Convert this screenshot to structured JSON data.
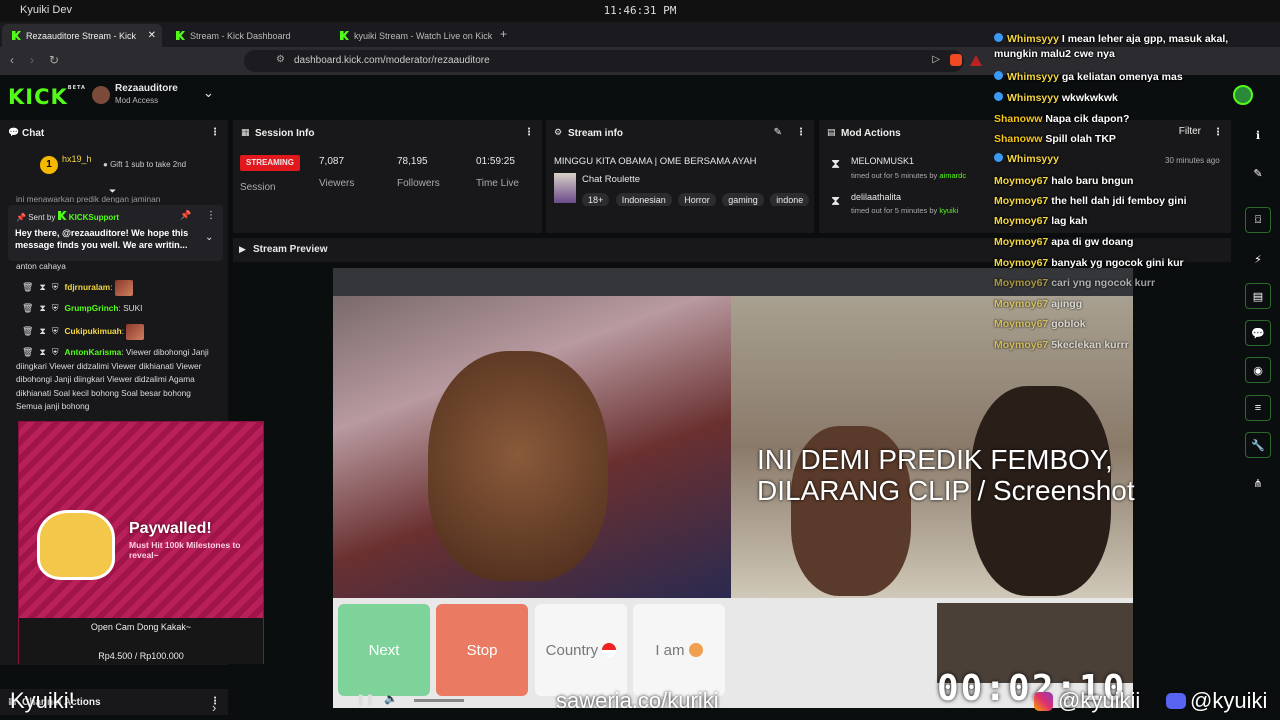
{
  "os": {
    "title": "Kyuiki Dev",
    "time": "11:46:31 PM"
  },
  "tabs": [
    {
      "label": "Rezaauditore Stream - Kick"
    },
    {
      "label": "Stream - Kick Dashboard"
    },
    {
      "label": "kyuiki Stream - Watch Live on Kick"
    }
  ],
  "url": "dashboard.kick.com/moderator/rezaauditore",
  "header": {
    "logo": "KICK",
    "beta": "BETA",
    "channel": "Rezaauditore",
    "role": "Mod Access"
  },
  "chat": {
    "title": "Chat",
    "sub_user": "hx19_h",
    "sub_count": "1",
    "sub_gift_btn": "Gift 1 sub to take 2nd",
    "partial": "ini menawarkan predik dengan jaminan",
    "pinned_by": "Sent by",
    "pinned_user": "KICKSupport",
    "pinned_msg": "Hey there, @rezaauditore! We hope this message finds you well. We are writin...",
    "pre": "anton cahaya",
    "messages": [
      {
        "user": "fdjrnuralam",
        "text": ":",
        "color": "#f5d742"
      },
      {
        "user": "GrumpGrinch",
        "text": ": SUKI",
        "color": "#53fc18"
      },
      {
        "user": "Cukipukimuah",
        "text": ":",
        "color": "#f5d742"
      },
      {
        "user": "AntonKarisma",
        "text": ": Viewer dibohongi Janji diingkari Viewer didzalimi Viewer dikhianati Viewer dibohongi Janji diingkari Viewer didzalimi Agama dikhianati Soal kecil bohong Soal besar bohong Semua janji bohong",
        "color": "#53fc18"
      }
    ]
  },
  "paywall": {
    "title": "Paywalled!",
    "sub": "Must Hit 100k Milestones to reveal~",
    "caption": "Open Cam Dong Kakak~",
    "amount": "Rp4.500 / Rp100.000"
  },
  "channel_actions": "Channel Actions",
  "session": {
    "title": "Session Info",
    "status": "STREAMING",
    "status_label": "Session",
    "viewers": "7,087",
    "viewers_label": "Viewers",
    "followers": "78,195",
    "followers_label": "Followers",
    "time": "01:59:25",
    "time_label": "Time Live"
  },
  "stream_info": {
    "title": "Stream info",
    "stream_title": "MINGGU KITA OBAMA | OME BERSAMA AYAH",
    "category": "Chat Roulette",
    "tags": [
      "18+",
      "Indonesian",
      "Horror",
      "gaming",
      "indone"
    ]
  },
  "mod_actions": {
    "title": "Mod Actions",
    "filter": "Filter",
    "items": [
      {
        "user": "MELONMUSK1",
        "detail": "timed out for 5 minutes by",
        "by": "aimardc"
      },
      {
        "user": "delilaathalita",
        "detail": "timed out for 5 minutes by",
        "by": "kyuiki"
      }
    ]
  },
  "preview": {
    "title": "Stream Preview",
    "overlay_text": "INI DEMI PREDIK FEMBOY, DILARANG CLIP / Screenshot",
    "buttons": [
      "Next",
      "Stop",
      "Country",
      "I am"
    ],
    "timer": "00:02:10"
  },
  "overlay_chat": [
    {
      "user": "Whimsyyy",
      "text": "I mean leher aja gpp, masuk akal, mungkin malu2 cwe nya",
      "color": "#f5d742",
      "icon": true
    },
    {
      "user": "Whimsyyy",
      "text": "ga keliatan omenya mas",
      "color": "#f5d742",
      "icon": true
    },
    {
      "user": "Whimsyyy",
      "text": "wkwkwkwk",
      "color": "#f5d742",
      "icon": true
    },
    {
      "user": "Shanoww",
      "text": "Napa cik dapon?",
      "color": "#f5c518",
      "icon": false
    },
    {
      "user": "Shanoww",
      "text": "Spill olah TKP",
      "color": "#f5c518",
      "icon": false
    },
    {
      "user": "Whimsyyy",
      "text": "",
      "color": "#f5d742",
      "icon": true
    },
    {
      "user": "Moymoy67",
      "text": "halo baru bngun",
      "color": "#f5d742",
      "icon": false
    },
    {
      "user": "Moymoy67",
      "text": "the hell dah jdi femboy gini",
      "color": "#f5d742",
      "icon": false
    },
    {
      "user": "Moymoy67",
      "text": "lag kah",
      "color": "#f5d742",
      "icon": false
    },
    {
      "user": "Moymoy67",
      "text": "apa di gw doang",
      "color": "#f5d742",
      "icon": false
    },
    {
      "user": "Moymoy67",
      "text": "banyak yg ngocok gini kur",
      "color": "#f5d742",
      "icon": false
    },
    {
      "user": "Moymoy67",
      "text": "cari yng ngocok kurr",
      "color": "#f5d742",
      "icon": false
    },
    {
      "user": "Moymoy67",
      "text": "ajingg",
      "color": "#f5d742",
      "icon": false
    },
    {
      "user": "Moymoy67",
      "text": "goblok",
      "color": "#f5d742",
      "icon": false
    },
    {
      "user": "Moymoy67",
      "text": "5keclekan kurrr",
      "color": "#f5d742",
      "icon": false
    }
  ],
  "mod_time": "30 minutes ago",
  "bottom": {
    "left": "Kyuiki!",
    "center": "saweria.co/kuriki",
    "ig": "@kyuikii",
    "discord": "@kyuiki"
  }
}
